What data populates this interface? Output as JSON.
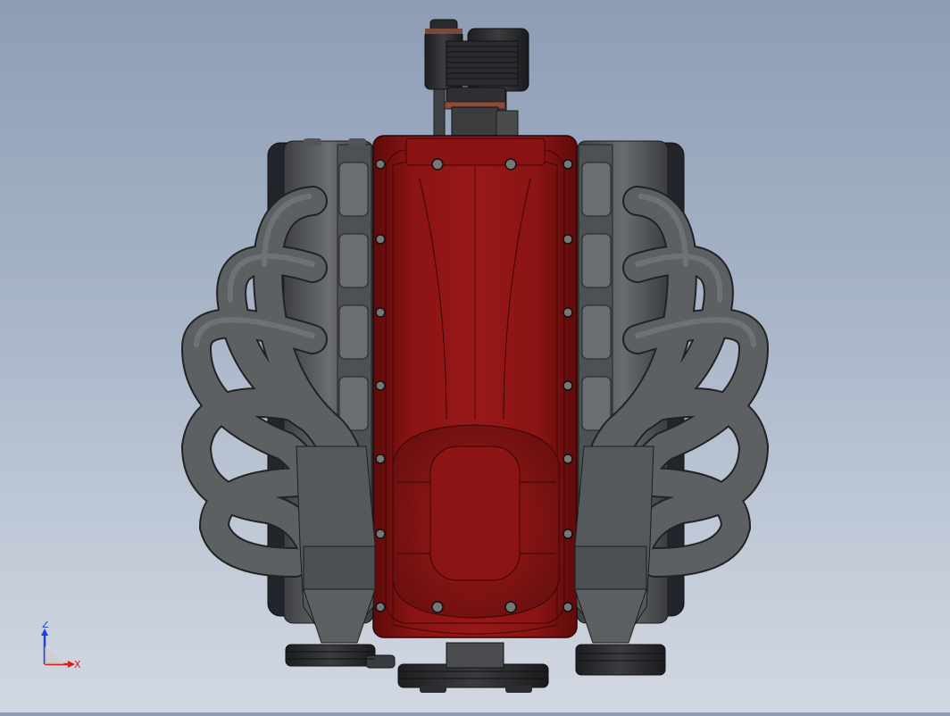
{
  "viewport": {
    "model": "v-engine-assembly",
    "view": "front"
  },
  "triad": {
    "z_label": "Z",
    "x_label": "X",
    "z_color": "#1f3fd8",
    "x_color": "#d42020"
  },
  "colors": {
    "background_top": "#8d9db5",
    "background_bottom": "#d2d8e2",
    "intake_manifold": "#8e1414",
    "block_gray": "#5b5e60",
    "exhaust_gray": "#5a5d5e",
    "dark_parts": "#2b2d30"
  }
}
